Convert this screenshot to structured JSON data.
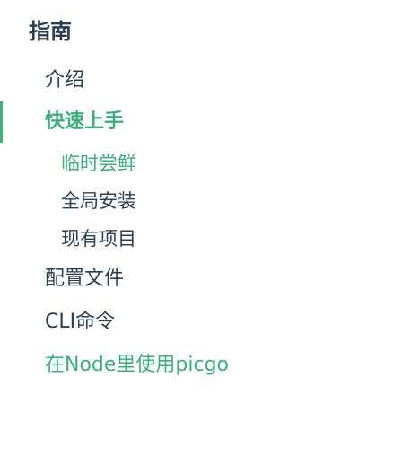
{
  "sidebar": {
    "group_title": "指南",
    "items": [
      {
        "label": "介绍"
      },
      {
        "label": "快速上手"
      },
      {
        "label": "配置文件"
      },
      {
        "label": "CLI命令"
      },
      {
        "label": "在Node里使用picgo"
      }
    ],
    "subitems": [
      {
        "label": "临时尝鲜"
      },
      {
        "label": "全局安装"
      },
      {
        "label": "现有项目"
      }
    ]
  },
  "colors": {
    "accent": "#3eaf7c",
    "text": "#2c3e50"
  }
}
